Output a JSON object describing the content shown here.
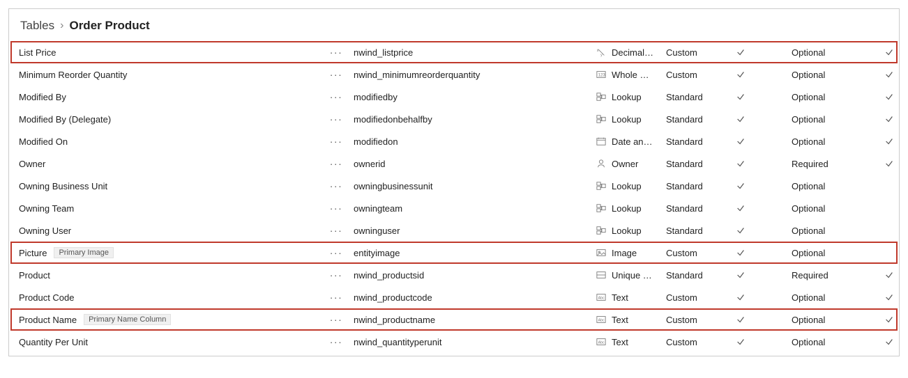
{
  "breadcrumb": {
    "root": "Tables",
    "sep": "›",
    "current": "Order Product"
  },
  "rows": [
    {
      "display": "List Price",
      "tag": "",
      "name": "nwind_listprice",
      "icon": "xy",
      "datatype": "Decimal…",
      "type": "Custom",
      "customizable": true,
      "required": "Optional",
      "searchable": true,
      "highlight": true
    },
    {
      "display": "Minimum Reorder Quantity",
      "tag": "",
      "name": "nwind_minimumreorderquantity",
      "icon": "num",
      "datatype": "Whole …",
      "type": "Custom",
      "customizable": true,
      "required": "Optional",
      "searchable": true,
      "highlight": false
    },
    {
      "display": "Modified By",
      "tag": "",
      "name": "modifiedby",
      "icon": "lookup",
      "datatype": "Lookup",
      "type": "Standard",
      "customizable": true,
      "required": "Optional",
      "searchable": true,
      "highlight": false
    },
    {
      "display": "Modified By (Delegate)",
      "tag": "",
      "name": "modifiedonbehalfby",
      "icon": "lookup",
      "datatype": "Lookup",
      "type": "Standard",
      "customizable": true,
      "required": "Optional",
      "searchable": true,
      "highlight": false
    },
    {
      "display": "Modified On",
      "tag": "",
      "name": "modifiedon",
      "icon": "date",
      "datatype": "Date an…",
      "type": "Standard",
      "customizable": true,
      "required": "Optional",
      "searchable": true,
      "highlight": false
    },
    {
      "display": "Owner",
      "tag": "",
      "name": "ownerid",
      "icon": "owner",
      "datatype": "Owner",
      "type": "Standard",
      "customizable": true,
      "required": "Required",
      "searchable": true,
      "highlight": false
    },
    {
      "display": "Owning Business Unit",
      "tag": "",
      "name": "owningbusinessunit",
      "icon": "lookup",
      "datatype": "Lookup",
      "type": "Standard",
      "customizable": true,
      "required": "Optional",
      "searchable": false,
      "highlight": false
    },
    {
      "display": "Owning Team",
      "tag": "",
      "name": "owningteam",
      "icon": "lookup",
      "datatype": "Lookup",
      "type": "Standard",
      "customizable": true,
      "required": "Optional",
      "searchable": false,
      "highlight": false
    },
    {
      "display": "Owning User",
      "tag": "",
      "name": "owninguser",
      "icon": "lookup",
      "datatype": "Lookup",
      "type": "Standard",
      "customizable": true,
      "required": "Optional",
      "searchable": false,
      "highlight": false
    },
    {
      "display": "Picture",
      "tag": "Primary Image",
      "name": "entityimage",
      "icon": "image",
      "datatype": "Image",
      "type": "Custom",
      "customizable": true,
      "required": "Optional",
      "searchable": false,
      "highlight": true
    },
    {
      "display": "Product",
      "tag": "",
      "name": "nwind_productsid",
      "icon": "unique",
      "datatype": "Unique …",
      "type": "Standard",
      "customizable": true,
      "required": "Required",
      "searchable": true,
      "highlight": false
    },
    {
      "display": "Product Code",
      "tag": "",
      "name": "nwind_productcode",
      "icon": "text",
      "datatype": "Text",
      "type": "Custom",
      "customizable": true,
      "required": "Optional",
      "searchable": true,
      "highlight": false
    },
    {
      "display": "Product Name",
      "tag": "Primary Name Column",
      "name": "nwind_productname",
      "icon": "text",
      "datatype": "Text",
      "type": "Custom",
      "customizable": true,
      "required": "Optional",
      "searchable": true,
      "highlight": true
    },
    {
      "display": "Quantity Per Unit",
      "tag": "",
      "name": "nwind_quantityperunit",
      "icon": "text",
      "datatype": "Text",
      "type": "Custom",
      "customizable": true,
      "required": "Optional",
      "searchable": true,
      "highlight": false
    }
  ],
  "more_glyph": "···"
}
